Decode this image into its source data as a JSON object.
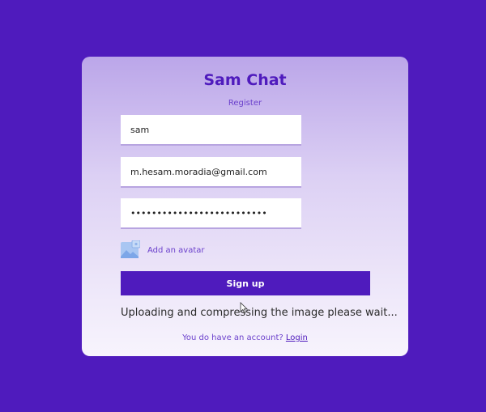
{
  "app": {
    "title": "Sam Chat",
    "subtitle": "Register"
  },
  "form": {
    "name_value": "sam",
    "email_value": "m.hesam.moradia@gmail.com",
    "password_value": "••••••••••••••••••••••••••",
    "avatar_label": "Add an avatar",
    "avatar_icon": "image-icon",
    "signup_label": "Sign up"
  },
  "status_text": "Uploading and compressing the image please wait...",
  "footer": {
    "text": "You do have an account?",
    "link_label": "Login"
  },
  "colors": {
    "background": "#4f1bbd",
    "accent": "#4f1bbd",
    "card_top": "#bba6e9",
    "card_bottom": "#f7f4fd"
  }
}
